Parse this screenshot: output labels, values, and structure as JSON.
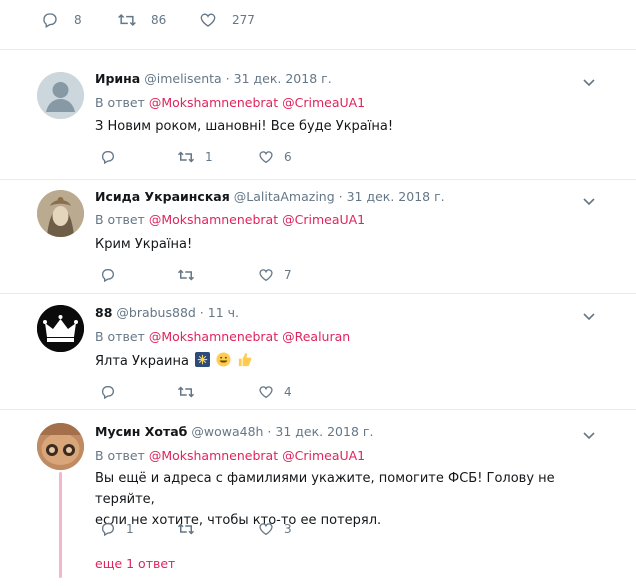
{
  "top_actions": {
    "replies": "8",
    "retweets": "86",
    "likes": "277"
  },
  "reply_prefix": "В ответ",
  "tweets": [
    {
      "name": "Ирина",
      "meta": "@imelisenta · 31 дек. 2018 г.",
      "mentions": [
        "@Mokshamnenebrat",
        "@CrimeaUA1"
      ],
      "text": "З Новим роком, шановні! Все буде Україна!",
      "replies": "",
      "retweets": "1",
      "likes": "6"
    },
    {
      "name": "Исида Украинская",
      "meta": "@LalitaAmazing · 31 дек. 2018 г.",
      "mentions": [
        "@Mokshamnenebrat",
        "@CrimeaUA1"
      ],
      "text": "Крим Україна!",
      "replies": "",
      "retweets": "",
      "likes": "7"
    },
    {
      "name": "88",
      "meta": "@brabus88d · 11 ч.",
      "mentions": [
        "@Mokshamnenebrat",
        "@Realuran"
      ],
      "text": "Ялта Украина",
      "replies": "",
      "retweets": "",
      "likes": "4"
    },
    {
      "name": "Мусин Хотаб",
      "meta": "@wowa48h · 31 дек. 2018 г.",
      "mentions": [
        "@Mokshamnenebrat",
        "@CrimeaUA1"
      ],
      "text_line1": "Вы ещё и адреса с фамилиями укажите, помогите ФСБ! Голову не теряйте,",
      "text_line2": "если не хотите, чтобы кто-то  ее потерял.",
      "replies": "1",
      "retweets": "",
      "likes": "3"
    }
  ],
  "more_replies": "еще 1 ответ",
  "colors": {
    "accent": "#e0245e",
    "muted": "#657786",
    "divider": "#e6ecf0"
  }
}
